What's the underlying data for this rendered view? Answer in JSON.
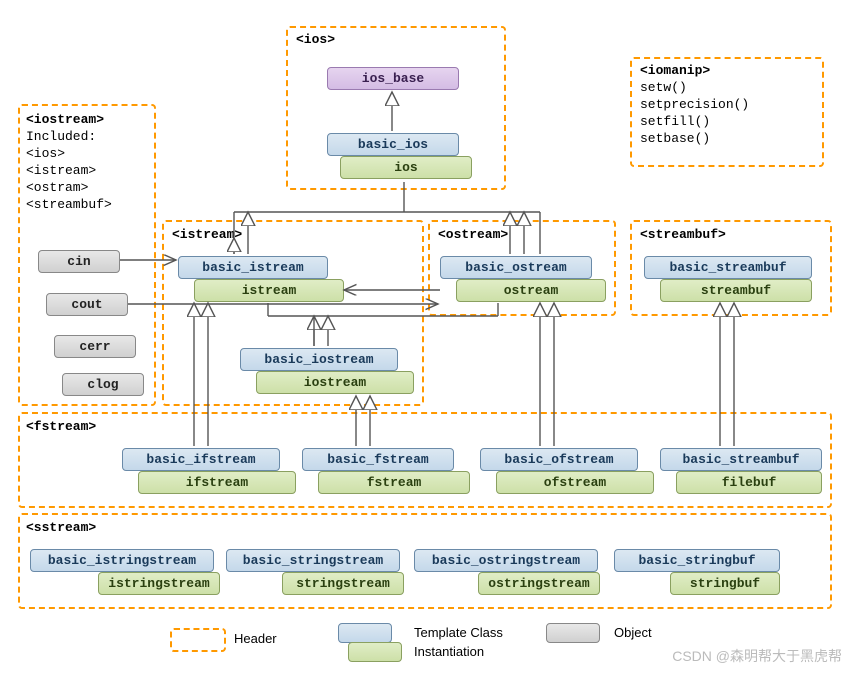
{
  "headers": {
    "ios": "<ios>",
    "iostream": "<iostream>",
    "istream": "<istream>",
    "ostream": "<ostream>",
    "streambuf": "<streambuf>",
    "iomanip": "<iomanip>",
    "fstream": "<fstream>",
    "sstream": "<sstream>"
  },
  "iostream_box": {
    "included_label": "Included:",
    "includes": [
      "<ios>",
      "<istream>",
      "<ostram>",
      "<streambuf>"
    ]
  },
  "iomanip_box": {
    "items": [
      "setw()",
      "setprecision()",
      "setfill()",
      "setbase()"
    ]
  },
  "classes": {
    "ios_base": "ios_base",
    "basic_ios": "basic_ios",
    "ios": "ios",
    "basic_istream": "basic_istream",
    "istream": "istream",
    "basic_ostream": "basic_ostream",
    "ostream": "ostream",
    "basic_iostream": "basic_iostream",
    "iostream": "iostream",
    "basic_streambuf": "basic_streambuf",
    "streambuf": "streambuf",
    "basic_ifstream": "basic_ifstream",
    "ifstream": "ifstream",
    "basic_fstream": "basic_fstream",
    "fstream": "fstream",
    "basic_ofstream": "basic_ofstream",
    "ofstream": "ofstream",
    "basic_streambuf2": "basic_streambuf",
    "filebuf": "filebuf",
    "basic_istringstream": "basic_istringstream",
    "istringstream": "istringstream",
    "basic_stringstream": "basic_stringstream",
    "stringstream": "stringstream",
    "basic_ostringstream": "basic_ostringstream",
    "ostringstream": "ostringstream",
    "basic_stringbuf": "basic_stringbuf",
    "stringbuf": "stringbuf"
  },
  "objects": {
    "cin": "cin",
    "cout": "cout",
    "cerr": "cerr",
    "clog": "clog"
  },
  "legend": {
    "header": "Header",
    "template": "Template Class",
    "instantiation": "Instantiation",
    "object": "Object"
  },
  "watermark": "CSDN @森明帮大于黑虎帮"
}
